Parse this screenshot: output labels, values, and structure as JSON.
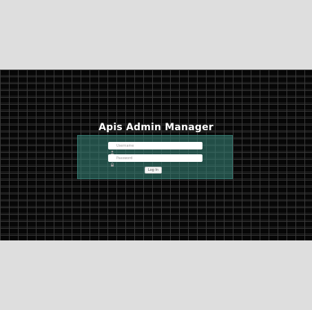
{
  "header": {
    "title": "Apis Admin Manager"
  },
  "login": {
    "username_placeholder": "Username",
    "password_placeholder": "Password",
    "submit_label": "Log In"
  },
  "icons": {
    "username": "user-icon",
    "password": "lock-icon"
  },
  "colors": {
    "background": "#dedede",
    "brick_wall": "#070707",
    "panel": "#347a70",
    "title_text": "#ffffff"
  }
}
